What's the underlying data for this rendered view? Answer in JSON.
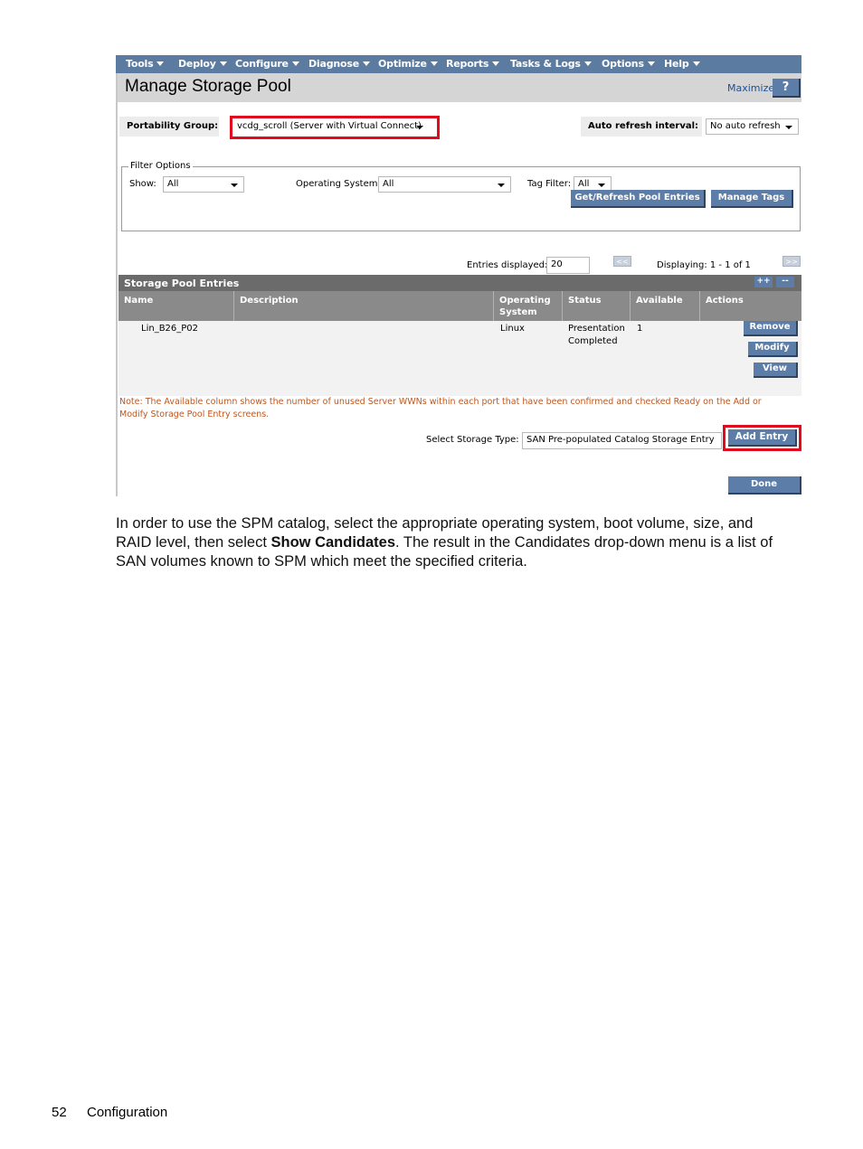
{
  "menu": [
    {
      "label": "Tools"
    },
    {
      "label": "Deploy"
    },
    {
      "label": "Configure"
    },
    {
      "label": "Diagnose"
    },
    {
      "label": "Optimize"
    },
    {
      "label": "Reports"
    },
    {
      "label": "Tasks & Logs"
    },
    {
      "label": "Options"
    },
    {
      "label": "Help"
    }
  ],
  "header": {
    "title": "Manage Storage Pool",
    "maximize": "Maximize",
    "help": "?"
  },
  "portability": {
    "label": "Portability Group:",
    "value": "vcdg_scroll (Server with Virtual Connect)"
  },
  "refresh": {
    "label": "Auto refresh interval:",
    "value": "No auto refresh"
  },
  "filter": {
    "legend": "Filter Options",
    "show_label": "Show:",
    "show_value": "All",
    "os_label": "Operating System:",
    "os_value": "All",
    "tag_label": "Tag Filter:",
    "tag_value": "All",
    "get_refresh": "Get/Refresh Pool Entries",
    "manage_tags": "Manage Tags"
  },
  "paging": {
    "entries_label": "Entries displayed:",
    "entries_value": "20",
    "prev": "<<",
    "next": ">>",
    "displaying": "Displaying: 1 - 1 of 1"
  },
  "table": {
    "title": "Storage Pool Entries",
    "expand": "++",
    "collapse": "--",
    "columns": [
      "Name",
      "Description",
      "Operating System",
      "Status",
      "Available",
      "Actions"
    ],
    "rows": [
      {
        "name": "Lin_B26_P02",
        "description": "",
        "os": "Linux",
        "status_line1": "Presentation",
        "status_line2": "Completed",
        "available": "1",
        "actions": [
          "Remove",
          "Modify",
          "View"
        ]
      }
    ]
  },
  "note": "Note: The Available column shows the number of unused Server WWNs within each port that have been confirmed and checked Ready on the Add or Modify Storage Pool Entry screens.",
  "storage_type": {
    "label": "Select Storage Type:",
    "value": "SAN Pre-populated Catalog Storage Entry",
    "add_entry": "Add Entry",
    "done": "Done"
  },
  "paragraph": {
    "part1": "In order to use the SPM catalog, select the appropriate operating system, boot volume, size, and RAID level, then select ",
    "bold": "Show Candidates",
    "part2": ". The result in the Candidates drop-down menu is a list of SAN volumes known to SPM which meet the specified criteria."
  },
  "footer": {
    "page_number": "52",
    "section": "Configuration"
  },
  "colors": {
    "menu_bar": "#5b7ca0",
    "button": "#5c7da8",
    "highlight_red": "#e00b1c",
    "note_orange": "#c0561e"
  }
}
